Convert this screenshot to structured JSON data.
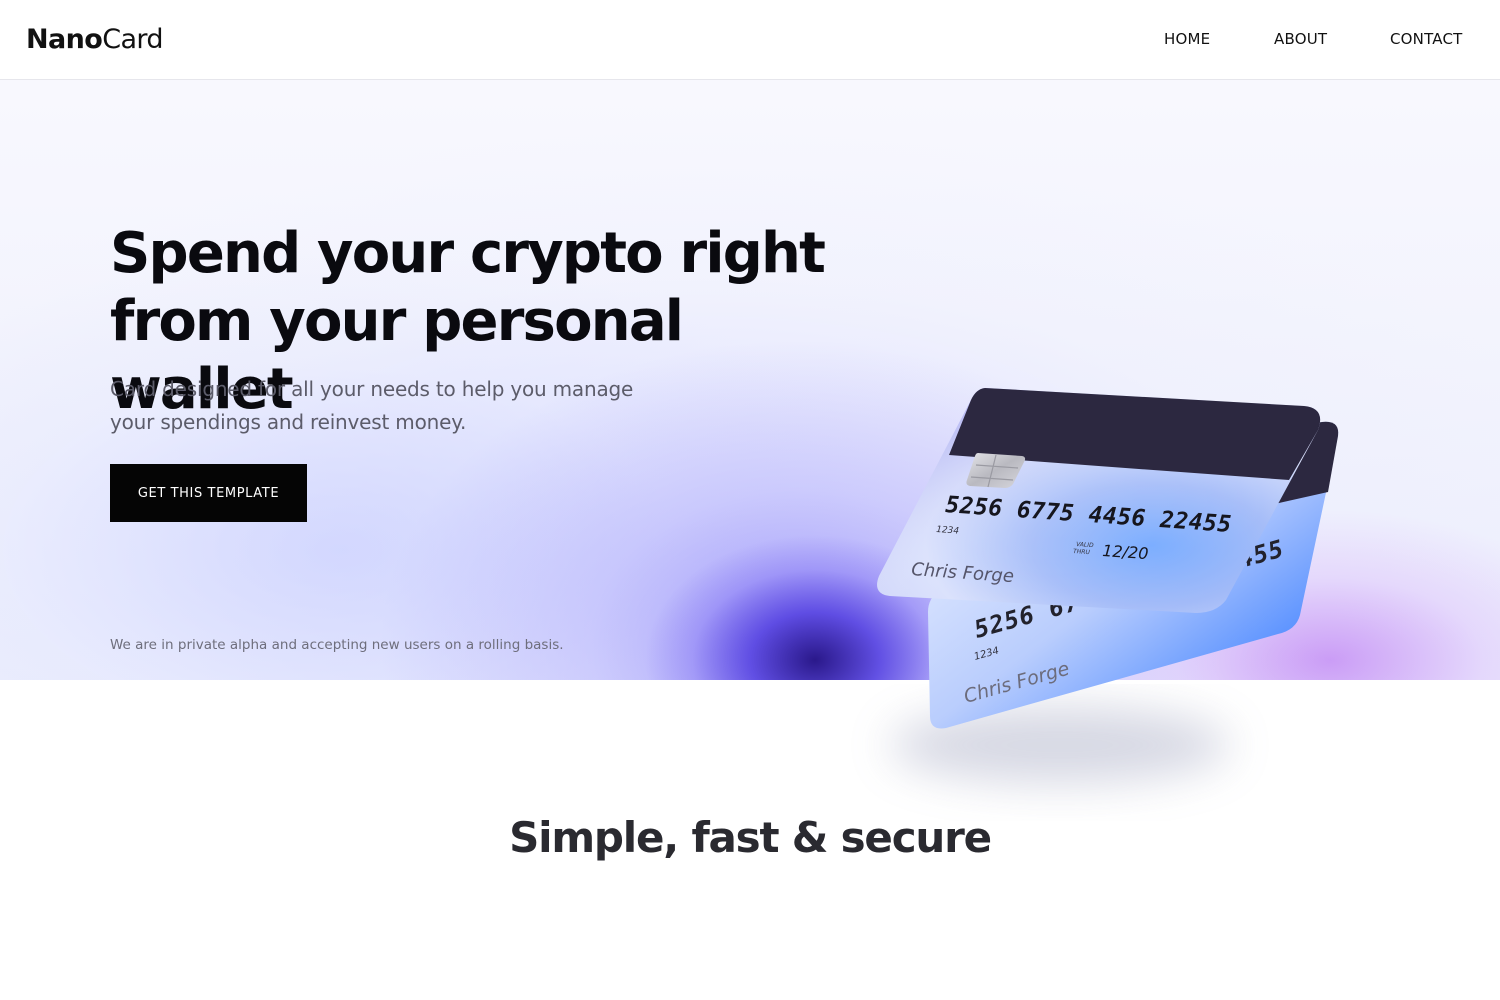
{
  "header": {
    "logo_bold": "Nano",
    "logo_light": "Card",
    "nav": [
      {
        "label": "HOME"
      },
      {
        "label": "ABOUT"
      },
      {
        "label": "CONTACT"
      }
    ]
  },
  "hero": {
    "headline_line1": "Spend your crypto right",
    "headline_line2": "from your personal wallet",
    "subtitle_line1": "Card designed for all your needs  to help you manage",
    "subtitle_line2": "your spendings and reinvest money.",
    "cta_label": "GET THIS TEMPLATE",
    "alpha_note": "We are in private alpha and accepting new users on a rolling basis."
  },
  "cards": {
    "front": {
      "number": "5256 6775 4456  22455",
      "small_code": "1234",
      "valid_label_top": "VALID",
      "valid_label_bottom": "THRU",
      "expiry": "12/20",
      "holder": "Chris Forge"
    },
    "back": {
      "number_partial": "5256 67",
      "number_end": "455",
      "small_code": "1234",
      "holder": "Chris Forge"
    }
  },
  "section_two": {
    "title": "Simple, fast & secure"
  },
  "colors": {
    "accent_purple": "#4a33e0",
    "card_stripe": "#2c2840",
    "cta_background": "#050505"
  }
}
